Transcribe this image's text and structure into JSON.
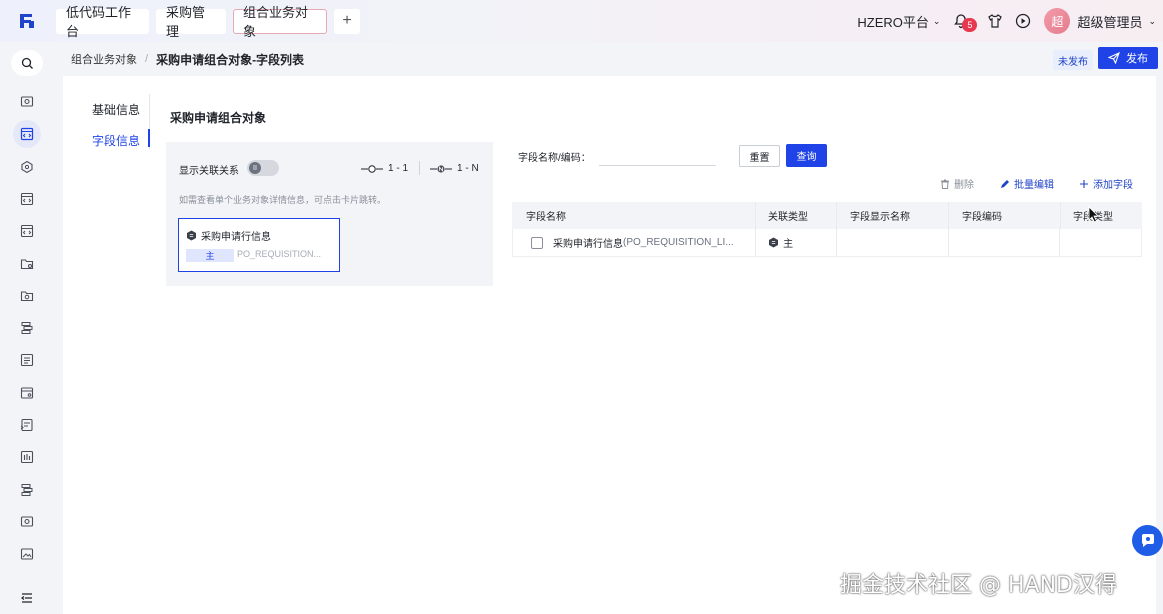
{
  "topbar": {
    "tabs": [
      "低代码工作台",
      "采购管理",
      "组合业务对象"
    ],
    "add_tab": "+",
    "platform": "HZERO平台",
    "notification_count": "5",
    "avatar_text": "超",
    "username": "超级管理员"
  },
  "breadcrumb": {
    "parent": "组合业务对象",
    "separator": "/",
    "current": "采购申请组合对象-字段列表"
  },
  "status": {
    "unpublished": "未发布",
    "publish_button": "发布"
  },
  "section_tabs": {
    "basic_info": "基础信息",
    "field_info": "字段信息"
  },
  "object": {
    "title": "采购申请组合对象"
  },
  "relation_panel": {
    "show_relation_label": "显示关联关系",
    "toggle_knob": "II",
    "legend_one_to_one": "1 - 1",
    "legend_one_to_many": "1 - N",
    "hint": "如需查看单个业务对象详情信息，可点击卡片跳转。",
    "card": {
      "title": "采购申请行信息",
      "tag": "主",
      "code": "PO_REQUISITION..."
    }
  },
  "filter": {
    "label": "字段名称/编码：",
    "value": "",
    "reset": "重置",
    "query": "查询"
  },
  "actions": {
    "delete": "删除",
    "batch_edit": "批量编辑",
    "add_field": "添加字段"
  },
  "table": {
    "columns": [
      "字段名称",
      "关联类型",
      "字段显示名称",
      "字段编码",
      "字段类型"
    ],
    "rows": [
      {
        "name": "采购申请行信息",
        "code": "(PO_REQUISITION_LI...",
        "relation": "主",
        "display_name": "",
        "field_code": "",
        "field_type": ""
      }
    ]
  },
  "watermark": "掘金技术社区 @ HAND汉得",
  "colors": {
    "primary": "#1f43e6",
    "badge": "#e8384f"
  }
}
